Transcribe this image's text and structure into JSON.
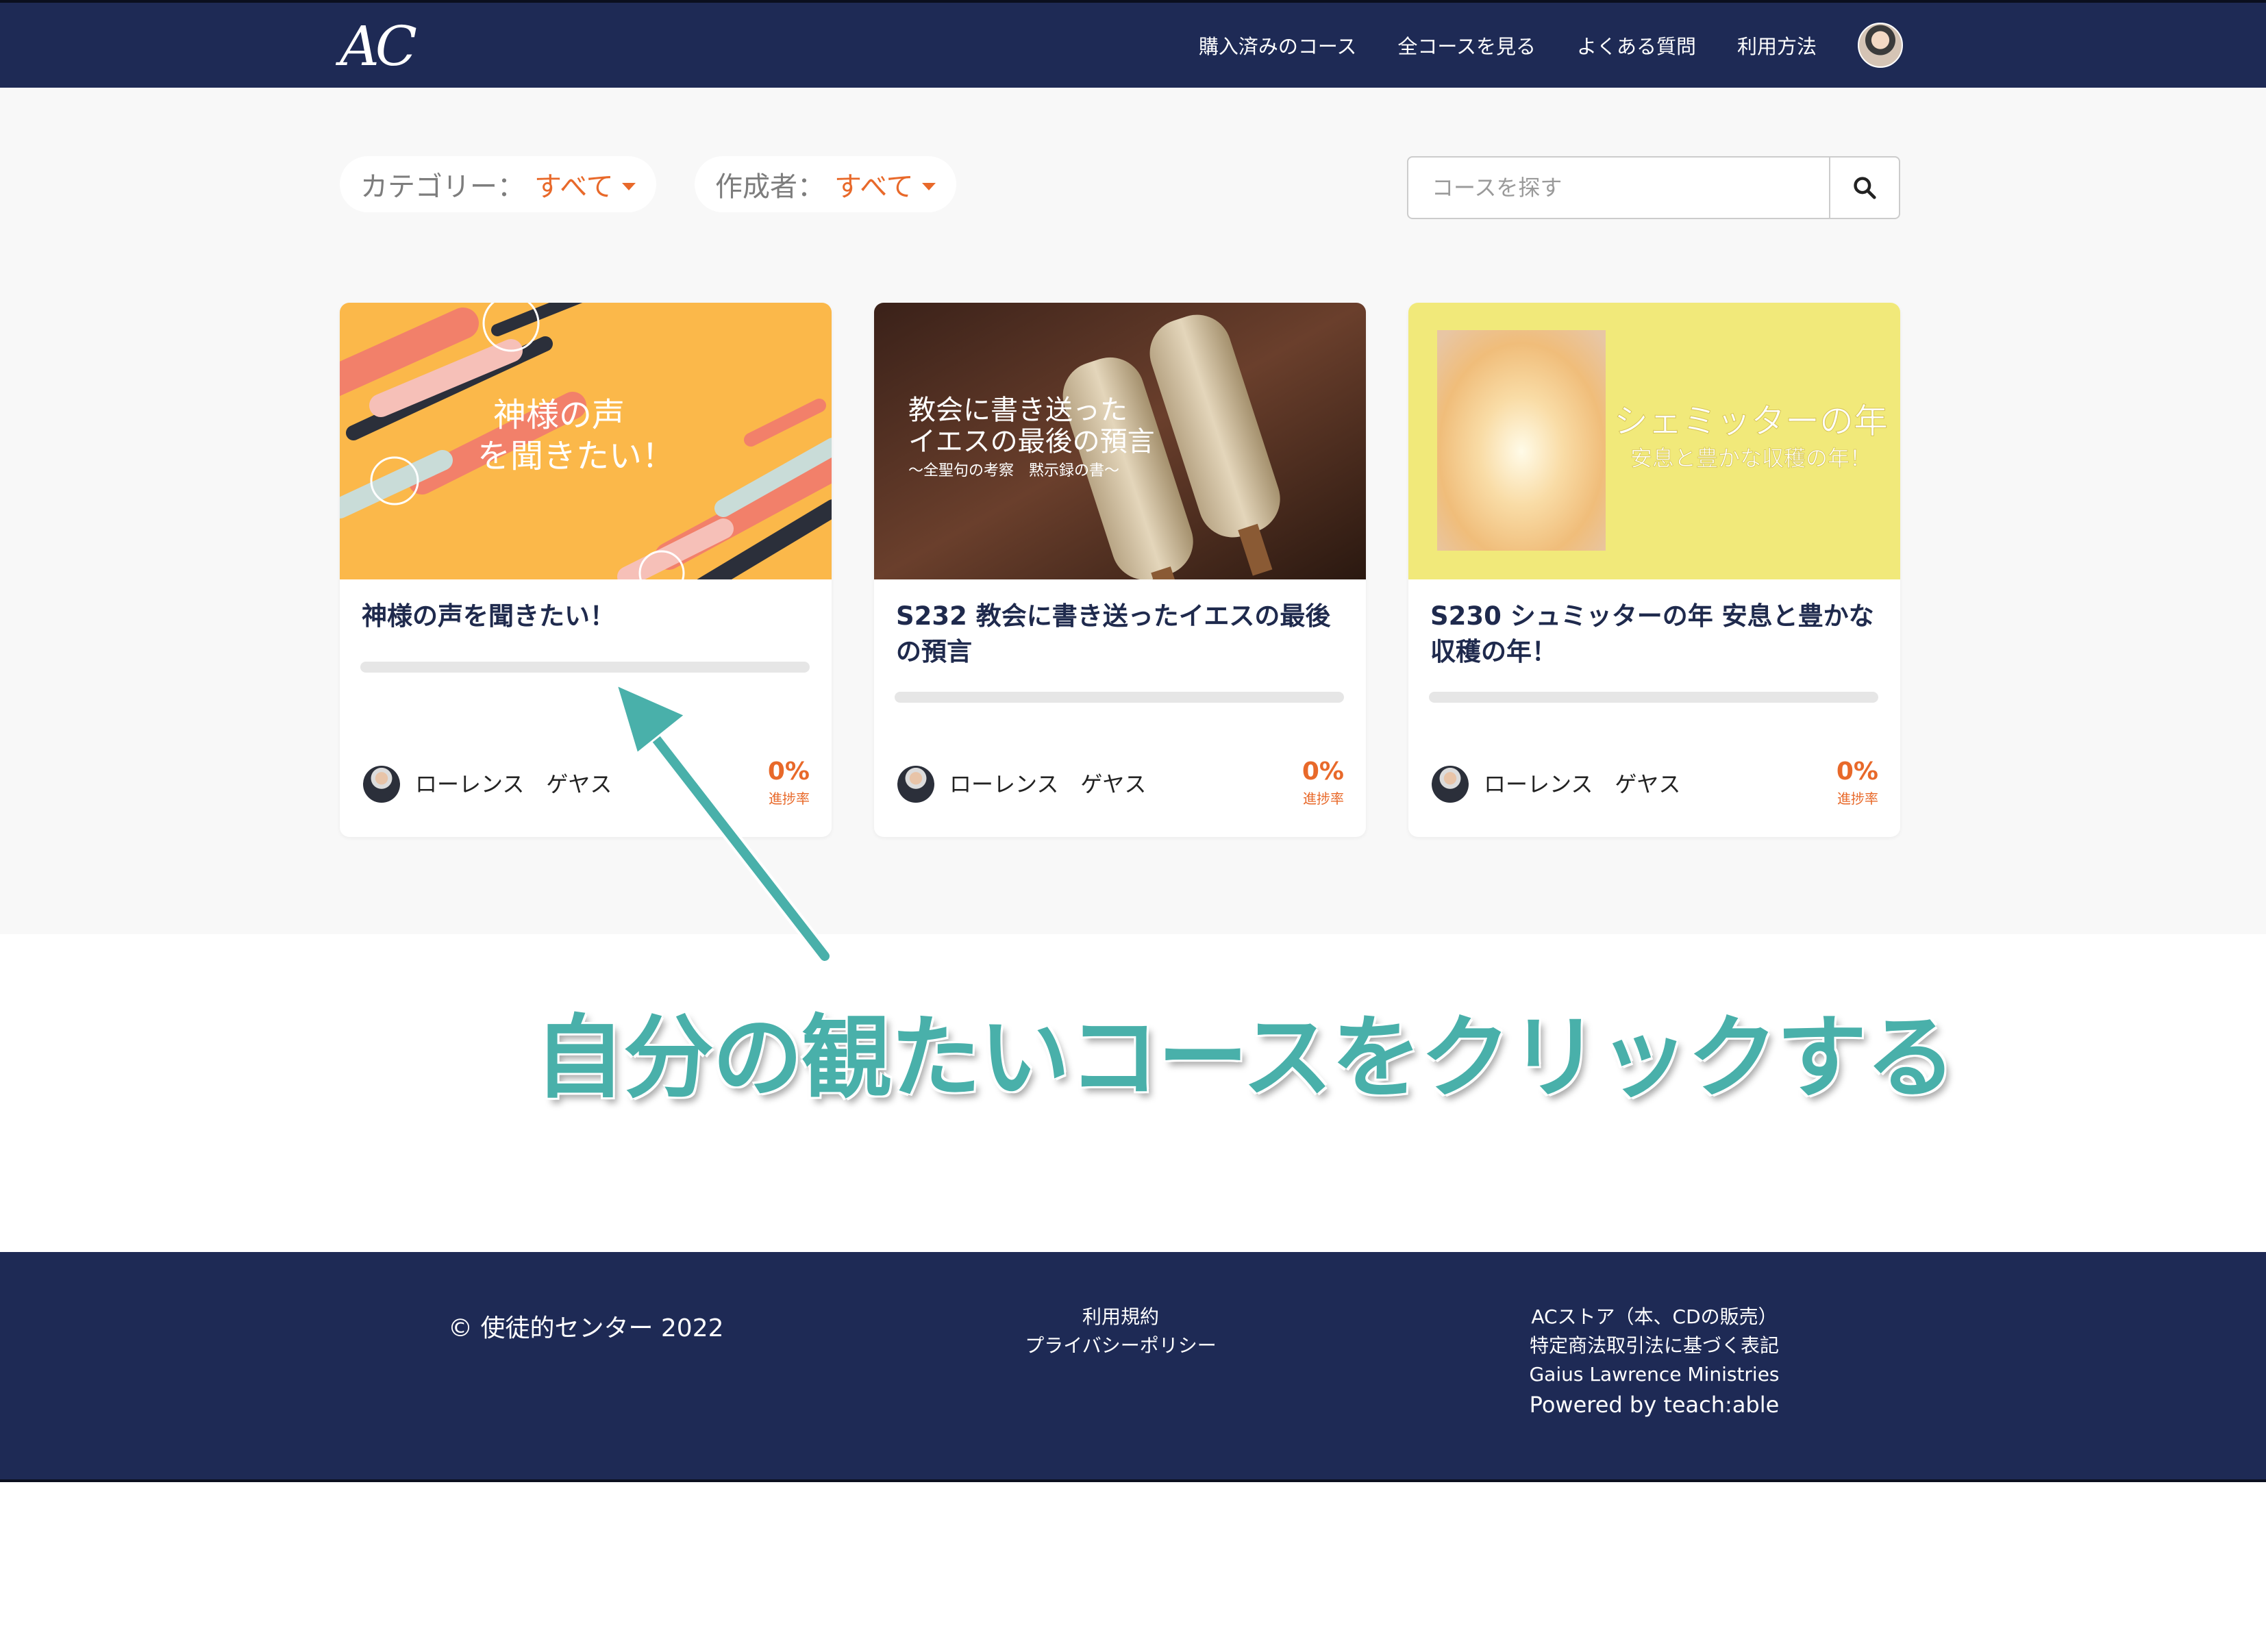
{
  "header": {
    "logo": "AC",
    "nav": [
      {
        "label": "購入済みのコース"
      },
      {
        "label": "全コースを見る"
      },
      {
        "label": "よくある質問"
      },
      {
        "label": "利用方法"
      }
    ]
  },
  "filters": {
    "category_label": "カテゴリー：",
    "category_value": "すべて",
    "author_label": "作成者：",
    "author_value": "すべて"
  },
  "search": {
    "placeholder": "コースを探す"
  },
  "courses": [
    {
      "title": "神様の声を聞きたい！",
      "image_text": [
        "神様の声",
        "を聞きたい！"
      ],
      "author": "ローレンス　ゲヤス",
      "progress": "0%",
      "progress_fraction": 0,
      "progress_label": "進捗率",
      "image_colors": {
        "background": "#fbb84a",
        "accent": "#f2806a",
        "dark": "#2b2f3a"
      }
    },
    {
      "title": "S232 教会に書き送ったイエスの最後の預言",
      "image_text": [
        "教会に書き送った",
        "イエスの最後の預言",
        "～全聖句の考察　黙示録の書～"
      ],
      "author": "ローレンス　ゲヤス",
      "progress": "0%",
      "progress_fraction": 0,
      "progress_label": "進捗率",
      "image_colors": {
        "background": "#4a2c22",
        "accent": "#d9c7a6"
      }
    },
    {
      "title": "S230 シュミッターの年 安息と豊かな収穫の年！",
      "image_text": [
        "シェミッターの年",
        "安息と豊かな収穫の年！"
      ],
      "author": "ローレンス　ゲヤス",
      "progress": "0%",
      "progress_fraction": 0,
      "progress_label": "進捗率",
      "image_colors": {
        "background": "#f1e97a",
        "accent": "#f7c98a"
      }
    }
  ],
  "annotation": "自分の観たいコースをクリックする",
  "footer": {
    "copyright": "© 使徒的センター 2022",
    "middle_links": [
      "利用規約",
      "プライバシーポリシー"
    ],
    "right_links": [
      "ACストア（本、CDの販売）",
      "特定商法取引法に基づく表記",
      "Gaius Lawrence Ministries"
    ],
    "powered": "Powered by teach:able"
  },
  "icons": {
    "search": "search-icon",
    "caret": "caret-down-icon",
    "user": "user-avatar"
  },
  "colors": {
    "navy": "#1e2a55",
    "orange": "#e8692a",
    "teal": "#49b0aa"
  }
}
